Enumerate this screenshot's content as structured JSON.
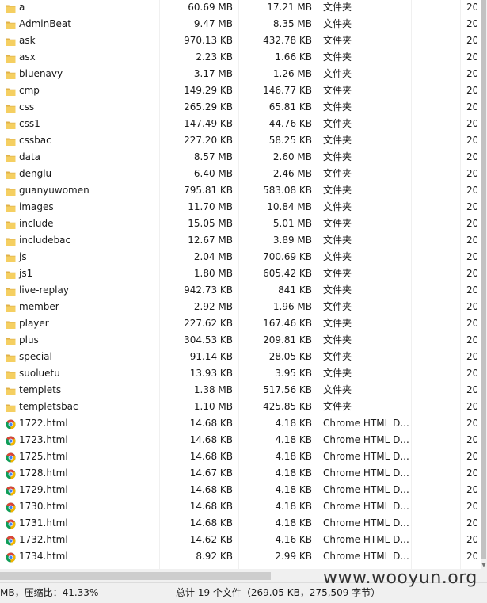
{
  "files": [
    {
      "name": "a",
      "size": "60.69 MB",
      "packed": "17.21 MB",
      "type": "文件夹",
      "date": "20",
      "icon": "folder-icon"
    },
    {
      "name": "AdminBeat",
      "size": "9.47 MB",
      "packed": "8.35 MB",
      "type": "文件夹",
      "date": "20",
      "icon": "folder-icon"
    },
    {
      "name": "ask",
      "size": "970.13 KB",
      "packed": "432.78 KB",
      "type": "文件夹",
      "date": "20",
      "icon": "folder-icon"
    },
    {
      "name": "asx",
      "size": "2.23 KB",
      "packed": "1.66 KB",
      "type": "文件夹",
      "date": "20",
      "icon": "folder-icon"
    },
    {
      "name": "bluenavy",
      "size": "3.17 MB",
      "packed": "1.26 MB",
      "type": "文件夹",
      "date": "20",
      "icon": "folder-icon"
    },
    {
      "name": "cmp",
      "size": "149.29 KB",
      "packed": "146.77 KB",
      "type": "文件夹",
      "date": "20",
      "icon": "folder-icon"
    },
    {
      "name": "css",
      "size": "265.29 KB",
      "packed": "65.81 KB",
      "type": "文件夹",
      "date": "20",
      "icon": "folder-icon"
    },
    {
      "name": "css1",
      "size": "147.49 KB",
      "packed": "44.76 KB",
      "type": "文件夹",
      "date": "20",
      "icon": "folder-icon"
    },
    {
      "name": "cssbac",
      "size": "227.20 KB",
      "packed": "58.25 KB",
      "type": "文件夹",
      "date": "20",
      "icon": "folder-icon"
    },
    {
      "name": "data",
      "size": "8.57 MB",
      "packed": "2.60 MB",
      "type": "文件夹",
      "date": "20",
      "icon": "folder-icon"
    },
    {
      "name": "denglu",
      "size": "6.40 MB",
      "packed": "2.46 MB",
      "type": "文件夹",
      "date": "20",
      "icon": "folder-icon"
    },
    {
      "name": "guanyuwomen",
      "size": "795.81 KB",
      "packed": "583.08 KB",
      "type": "文件夹",
      "date": "20",
      "icon": "folder-icon"
    },
    {
      "name": "images",
      "size": "11.70 MB",
      "packed": "10.84 MB",
      "type": "文件夹",
      "date": "20",
      "icon": "folder-icon"
    },
    {
      "name": "include",
      "size": "15.05 MB",
      "packed": "5.01 MB",
      "type": "文件夹",
      "date": "20",
      "icon": "folder-icon"
    },
    {
      "name": "includebac",
      "size": "12.67 MB",
      "packed": "3.89 MB",
      "type": "文件夹",
      "date": "20",
      "icon": "folder-icon"
    },
    {
      "name": "js",
      "size": "2.04 MB",
      "packed": "700.69 KB",
      "type": "文件夹",
      "date": "20",
      "icon": "folder-icon"
    },
    {
      "name": "js1",
      "size": "1.80 MB",
      "packed": "605.42 KB",
      "type": "文件夹",
      "date": "20",
      "icon": "folder-icon"
    },
    {
      "name": "live-replay",
      "size": "942.73 KB",
      "packed": "841 KB",
      "type": "文件夹",
      "date": "20",
      "icon": "folder-icon"
    },
    {
      "name": "member",
      "size": "2.92 MB",
      "packed": "1.96 MB",
      "type": "文件夹",
      "date": "20",
      "icon": "folder-icon"
    },
    {
      "name": "player",
      "size": "227.62 KB",
      "packed": "167.46 KB",
      "type": "文件夹",
      "date": "20",
      "icon": "folder-icon"
    },
    {
      "name": "plus",
      "size": "304.53 KB",
      "packed": "209.81 KB",
      "type": "文件夹",
      "date": "20",
      "icon": "folder-icon"
    },
    {
      "name": "special",
      "size": "91.14 KB",
      "packed": "28.05 KB",
      "type": "文件夹",
      "date": "20",
      "icon": "folder-icon"
    },
    {
      "name": "suoluetu",
      "size": "13.93 KB",
      "packed": "3.95 KB",
      "type": "文件夹",
      "date": "20",
      "icon": "folder-icon"
    },
    {
      "name": "templets",
      "size": "1.38 MB",
      "packed": "517.56 KB",
      "type": "文件夹",
      "date": "20",
      "icon": "folder-icon"
    },
    {
      "name": "templetsbac",
      "size": "1.10 MB",
      "packed": "425.85 KB",
      "type": "文件夹",
      "date": "20",
      "icon": "folder-icon"
    },
    {
      "name": "1722.html",
      "size": "14.68 KB",
      "packed": "4.18 KB",
      "type": "Chrome HTML D...",
      "date": "20",
      "icon": "chrome-icon"
    },
    {
      "name": "1723.html",
      "size": "14.68 KB",
      "packed": "4.18 KB",
      "type": "Chrome HTML D...",
      "date": "20",
      "icon": "chrome-icon"
    },
    {
      "name": "1725.html",
      "size": "14.68 KB",
      "packed": "4.18 KB",
      "type": "Chrome HTML D...",
      "date": "20",
      "icon": "chrome-icon"
    },
    {
      "name": "1728.html",
      "size": "14.67 KB",
      "packed": "4.18 KB",
      "type": "Chrome HTML D...",
      "date": "20",
      "icon": "chrome-icon"
    },
    {
      "name": "1729.html",
      "size": "14.68 KB",
      "packed": "4.18 KB",
      "type": "Chrome HTML D...",
      "date": "20",
      "icon": "chrome-icon"
    },
    {
      "name": "1730.html",
      "size": "14.68 KB",
      "packed": "4.18 KB",
      "type": "Chrome HTML D...",
      "date": "20",
      "icon": "chrome-icon"
    },
    {
      "name": "1731.html",
      "size": "14.68 KB",
      "packed": "4.18 KB",
      "type": "Chrome HTML D...",
      "date": "20",
      "icon": "chrome-icon"
    },
    {
      "name": "1732.html",
      "size": "14.62 KB",
      "packed": "4.16 KB",
      "type": "Chrome HTML D...",
      "date": "20",
      "icon": "chrome-icon"
    },
    {
      "name": "1734.html",
      "size": "8.92 KB",
      "packed": "2.99 KB",
      "type": "Chrome HTML D...",
      "date": "20",
      "icon": "chrome-icon"
    }
  ],
  "colors": {
    "folder": "#f5cf61",
    "folder_dark": "#e0b24a",
    "chrome_red": "#db4437",
    "chrome_green": "#0f9d58",
    "chrome_yellow": "#f4b400",
    "chrome_blue": "#4285f4"
  },
  "status": {
    "left": "MB，压缩比：41.33%",
    "mid": "总计 19 个文件（269.05 KB，275,509 字节）"
  },
  "watermark": "www.wooyun.org"
}
